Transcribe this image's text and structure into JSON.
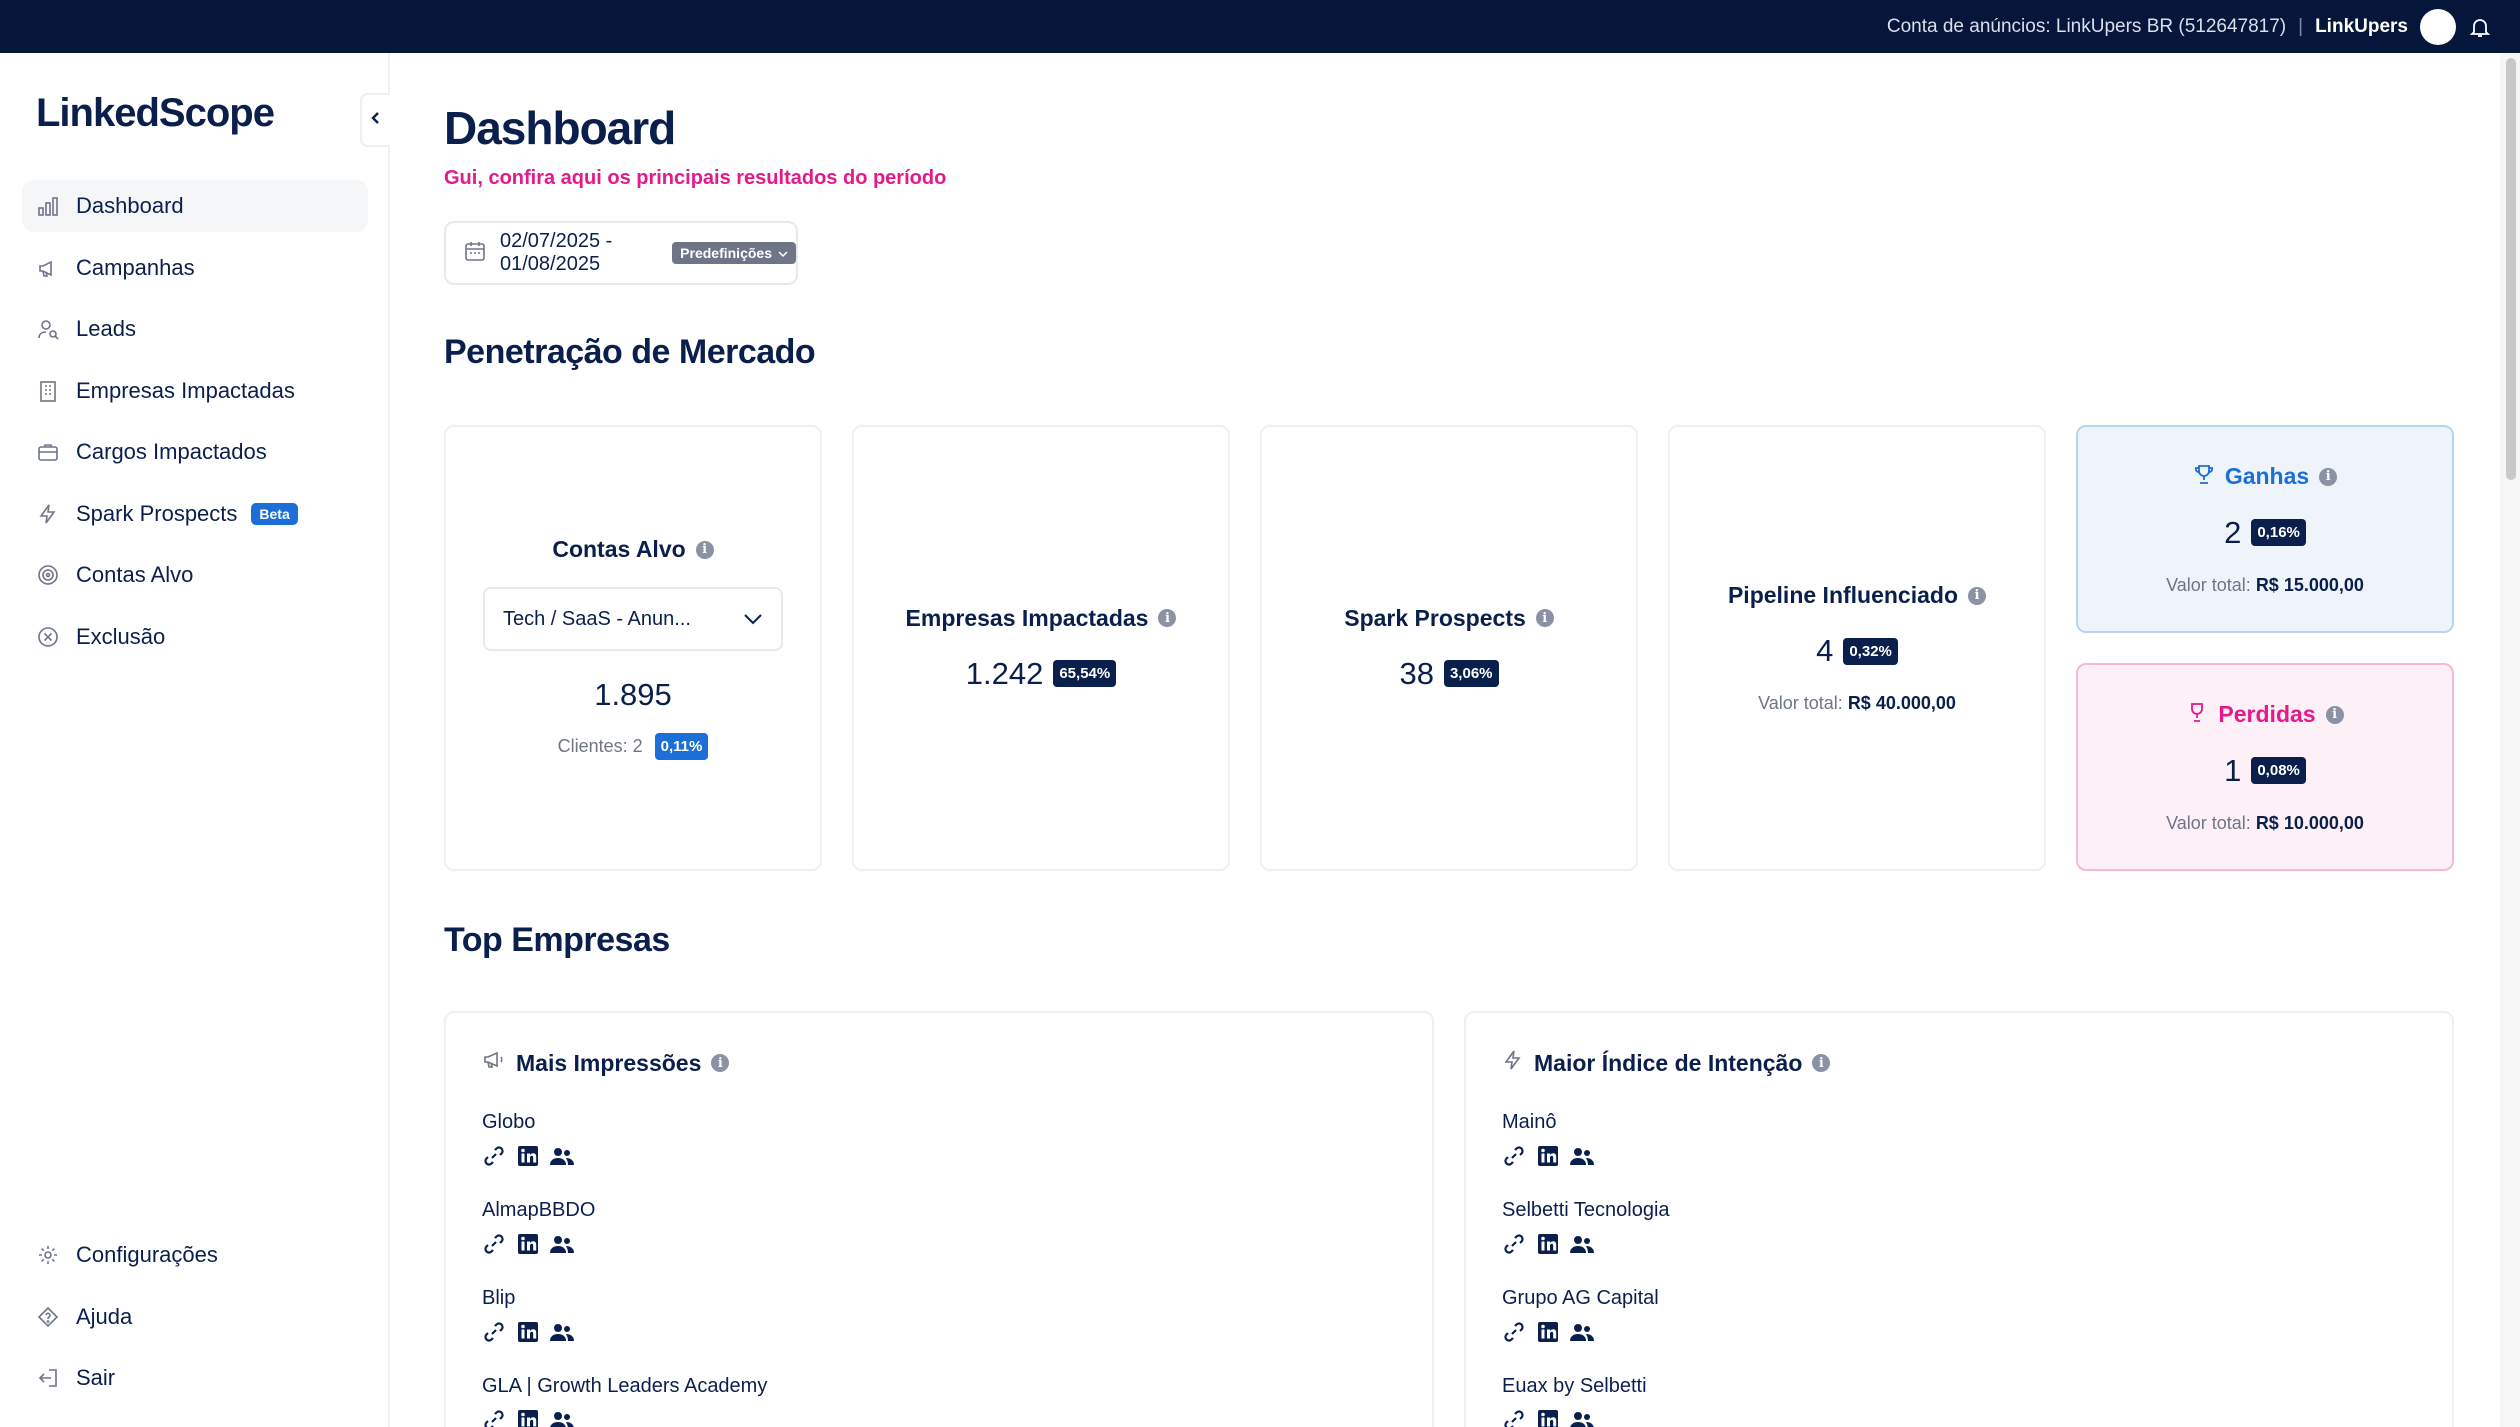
{
  "topbar": {
    "account": "Conta de anúncios: LinkUpers BR (512647817)",
    "separator": "|",
    "user": "LinkUpers"
  },
  "sidebar": {
    "logo": "LinkedScope",
    "items": [
      {
        "label": "Dashboard",
        "icon": "bar-chart-icon",
        "active": true
      },
      {
        "label": "Campanhas",
        "icon": "megaphone-icon"
      },
      {
        "label": "Leads",
        "icon": "user-search-icon"
      },
      {
        "label": "Empresas Impactadas",
        "icon": "building-icon"
      },
      {
        "label": "Cargos Impactados",
        "icon": "briefcase-icon"
      },
      {
        "label": "Spark Prospects",
        "icon": "lightning-icon",
        "badge": "Beta"
      },
      {
        "label": "Contas Alvo",
        "icon": "target-icon"
      },
      {
        "label": "Exclusão",
        "icon": "x-circle-icon"
      }
    ],
    "bottom_items": [
      {
        "label": "Configurações",
        "icon": "gear-icon"
      },
      {
        "label": "Ajuda",
        "icon": "help-icon"
      },
      {
        "label": "Sair",
        "icon": "logout-icon"
      }
    ]
  },
  "main": {
    "title": "Dashboard",
    "subtitle": "Gui, confira aqui os principais resultados do período",
    "date_range": "02/07/2025 - 01/08/2025",
    "presets_label": "Predefinições",
    "market_section_title": "Penetração de Mercado",
    "cards": {
      "contas_alvo": {
        "title": "Contas Alvo",
        "selected": "Tech / SaaS - Anun...",
        "value": "1.895",
        "clients_label": "Clientes: 2",
        "clients_pct": "0,11%"
      },
      "empresas": {
        "title": "Empresas Impactadas",
        "value": "1.242",
        "pct": "65,54%"
      },
      "spark": {
        "title": "Spark Prospects",
        "value": "38",
        "pct": "3,06%"
      },
      "pipeline": {
        "title": "Pipeline Influenciado",
        "value": "4",
        "pct": "0,32%",
        "total_label": "Valor total:",
        "total_value": "R$ 40.000,00"
      },
      "ganhas": {
        "title": "Ganhas",
        "value": "2",
        "pct": "0,16%",
        "total_label": "Valor total:",
        "total_value": "R$ 15.000,00"
      },
      "perdidas": {
        "title": "Perdidas",
        "value": "1",
        "pct": "0,08%",
        "total_label": "Valor total:",
        "total_value": "R$ 10.000,00"
      }
    },
    "top_section_title": "Top Empresas",
    "impressions": {
      "title": "Mais Impressões",
      "items": [
        "Globo",
        "AlmapBBDO",
        "Blip",
        "GLA | Growth Leaders Academy"
      ]
    },
    "intent": {
      "title": "Maior Índice de Intenção",
      "items": [
        "Mainô",
        "Selbetti Tecnologia",
        "Grupo AG Capital",
        "Euax by Selbetti"
      ]
    }
  },
  "colors": {
    "navy": "#0b1f4d",
    "topbar": "#06153a",
    "accent_pink": "#e5198a",
    "accent_blue": "#1b6fd6"
  }
}
